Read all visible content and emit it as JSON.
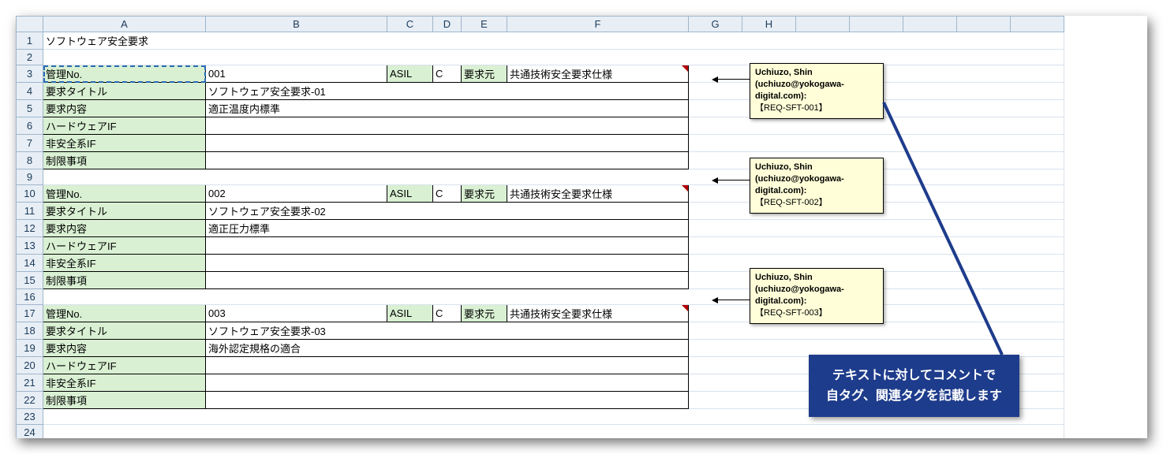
{
  "columns": [
    "",
    "A",
    "B",
    "C",
    "D",
    "E",
    "F",
    "G",
    "H"
  ],
  "title": "ソフトウェア安全要求",
  "labels": {
    "mgmtNo": "管理No.",
    "asil": "ASIL",
    "src": "要求元",
    "reqTitle": "要求タイトル",
    "reqBody": "要求内容",
    "hwIF": "ハードウェアIF",
    "nonSafeIF": "非安全系IF",
    "restrict": "制限事項"
  },
  "blocks": [
    {
      "no": "001",
      "asilGrade": "C",
      "source": "共通技術安全要求仕様",
      "title": "ソフトウェア安全要求-01",
      "body": "適正温度内標準",
      "hw": "",
      "ns": "",
      "rs": ""
    },
    {
      "no": "002",
      "asilGrade": "C",
      "source": "共通技術安全要求仕様",
      "title": "ソフトウェア安全要求-02",
      "body": "適正圧力標準",
      "hw": "",
      "ns": "",
      "rs": ""
    },
    {
      "no": "003",
      "asilGrade": "C",
      "source": "共通技術安全要求仕様",
      "title": "ソフトウェア安全要求-03",
      "body": "海外認定規格の適合",
      "hw": "",
      "ns": "",
      "rs": ""
    }
  ],
  "commentAuthor": "Uchiuzo, Shin (uchiuzo@yokogawa-digital.com):",
  "comments": [
    {
      "tag": "【REQ-SFT-001】"
    },
    {
      "tag": "【REQ-SFT-002】"
    },
    {
      "tag": "【REQ-SFT-003】"
    }
  ],
  "callout": {
    "line1": "テキストに対してコメントで",
    "line2": "自タグ、関連タグを記載します"
  }
}
